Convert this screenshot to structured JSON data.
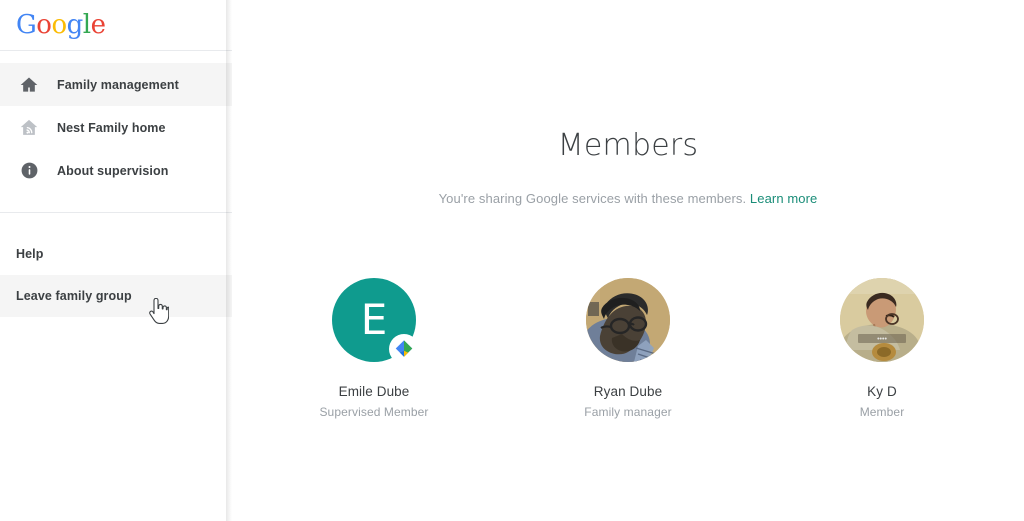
{
  "brand": {
    "name": "Google",
    "letters": [
      {
        "ch": "G",
        "color": "#4285F4"
      },
      {
        "ch": "o",
        "color": "#EA4335"
      },
      {
        "ch": "o",
        "color": "#FBBC05"
      },
      {
        "ch": "g",
        "color": "#4285F4"
      },
      {
        "ch": "l",
        "color": "#34A853"
      },
      {
        "ch": "e",
        "color": "#EA4335"
      }
    ]
  },
  "sidebar": {
    "items": [
      {
        "label": "Family management",
        "icon": "home-icon",
        "active": true
      },
      {
        "label": "Nest Family home",
        "icon": "nest-home-icon",
        "active": false
      },
      {
        "label": "About supervision",
        "icon": "info-icon",
        "active": false
      }
    ],
    "footer_items": [
      {
        "label": "Help",
        "hover": false
      },
      {
        "label": "Leave family group",
        "hover": true
      }
    ]
  },
  "main": {
    "title": "Members",
    "subtitle_text": "You're sharing Google services with these members.",
    "learn_more_label": "Learn more",
    "learn_more_color": "#1a8d78",
    "members": [
      {
        "name": "Emile Dube",
        "role": "Supervised Member",
        "avatar_type": "initial",
        "initial": "E",
        "avatar_color": "#0f9b8e",
        "badge": "family-link-icon"
      },
      {
        "name": "Ryan Dube",
        "role": "Family manager",
        "avatar_type": "photo",
        "initial": "",
        "avatar_color": "#c8b07e",
        "badge": ""
      },
      {
        "name": "Ky D",
        "role": "Member",
        "avatar_type": "photo",
        "initial": "",
        "avatar_color": "#d8c79a",
        "badge": ""
      }
    ]
  },
  "cursor": {
    "type": "pointer-hand-cursor"
  }
}
